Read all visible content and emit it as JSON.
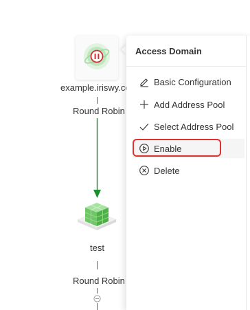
{
  "topology": {
    "domain_label": "example.iriswy.com",
    "policy_label_1": "Round Robin",
    "pool_label": "test",
    "policy_label_2": "Round Robin"
  },
  "menu": {
    "title": "Access Domain",
    "items": [
      {
        "label": "Basic Configuration",
        "icon": "edit-icon"
      },
      {
        "label": "Add Address Pool",
        "icon": "plus-icon"
      },
      {
        "label": "Select Address Pool",
        "icon": "check-icon"
      },
      {
        "label": "Enable",
        "icon": "play-circle-icon"
      },
      {
        "label": "Delete",
        "icon": "x-circle-icon"
      }
    ]
  },
  "colors": {
    "flow_line": "#1a8f2e",
    "highlight": "#e0312f",
    "paused_badge": "#d0312d"
  }
}
